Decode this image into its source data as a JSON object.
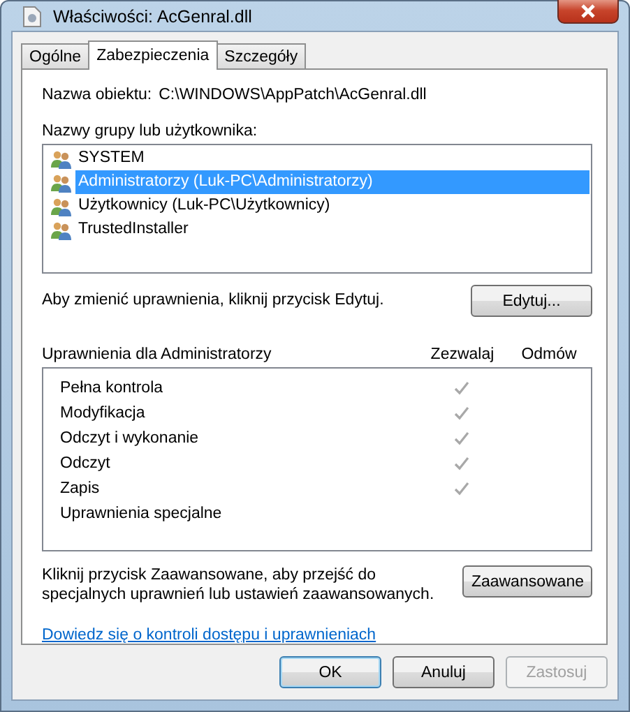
{
  "window": {
    "title": "Właściwości: AcGenral.dll"
  },
  "tabs": [
    {
      "label": "Ogólne",
      "selected": false
    },
    {
      "label": "Zabezpieczenia",
      "selected": true
    },
    {
      "label": "Szczegóły",
      "selected": false
    }
  ],
  "object_name": {
    "label": "Nazwa obiektu:",
    "value": "C:\\WINDOWS\\AppPatch\\AcGenral.dll"
  },
  "groups_label": "Nazwy grupy lub użytkownika:",
  "groups": [
    {
      "name": "SYSTEM",
      "selected": false
    },
    {
      "name": "Administratorzy (Luk-PC\\Administratorzy)",
      "selected": true
    },
    {
      "name": "Użytkownicy (Luk-PC\\Użytkownicy)",
      "selected": false
    },
    {
      "name": "TrustedInstaller",
      "selected": false
    }
  ],
  "edit_hint": "Aby zmienić uprawnienia, kliknij przycisk Edytuj.",
  "edit_button": "Edytuj...",
  "permissions": {
    "title": "Uprawnienia dla Administratorzy",
    "allow_header": "Zezwalaj",
    "deny_header": "Odmów",
    "rows": [
      {
        "name": "Pełna kontrola",
        "allow": true,
        "deny": false
      },
      {
        "name": "Modyfikacja",
        "allow": true,
        "deny": false
      },
      {
        "name": "Odczyt i wykonanie",
        "allow": true,
        "deny": false
      },
      {
        "name": "Odczyt",
        "allow": true,
        "deny": false
      },
      {
        "name": "Zapis",
        "allow": true,
        "deny": false
      },
      {
        "name": "Uprawnienia specjalne",
        "allow": false,
        "deny": false
      }
    ]
  },
  "advanced_hint": "Kliknij przycisk Zaawansowane, aby przejść do specjalnych uprawnień lub ustawień zaawansowanych.",
  "advanced_button": "Zaawansowane",
  "link": "Dowiedz się o kontroli dostępu i uprawnieniach",
  "buttons": [
    {
      "label": "OK",
      "disabled": false,
      "default": true
    },
    {
      "label": "Anuluj",
      "disabled": false,
      "default": false
    },
    {
      "label": "Zastosuj",
      "disabled": true,
      "default": false
    }
  ]
}
